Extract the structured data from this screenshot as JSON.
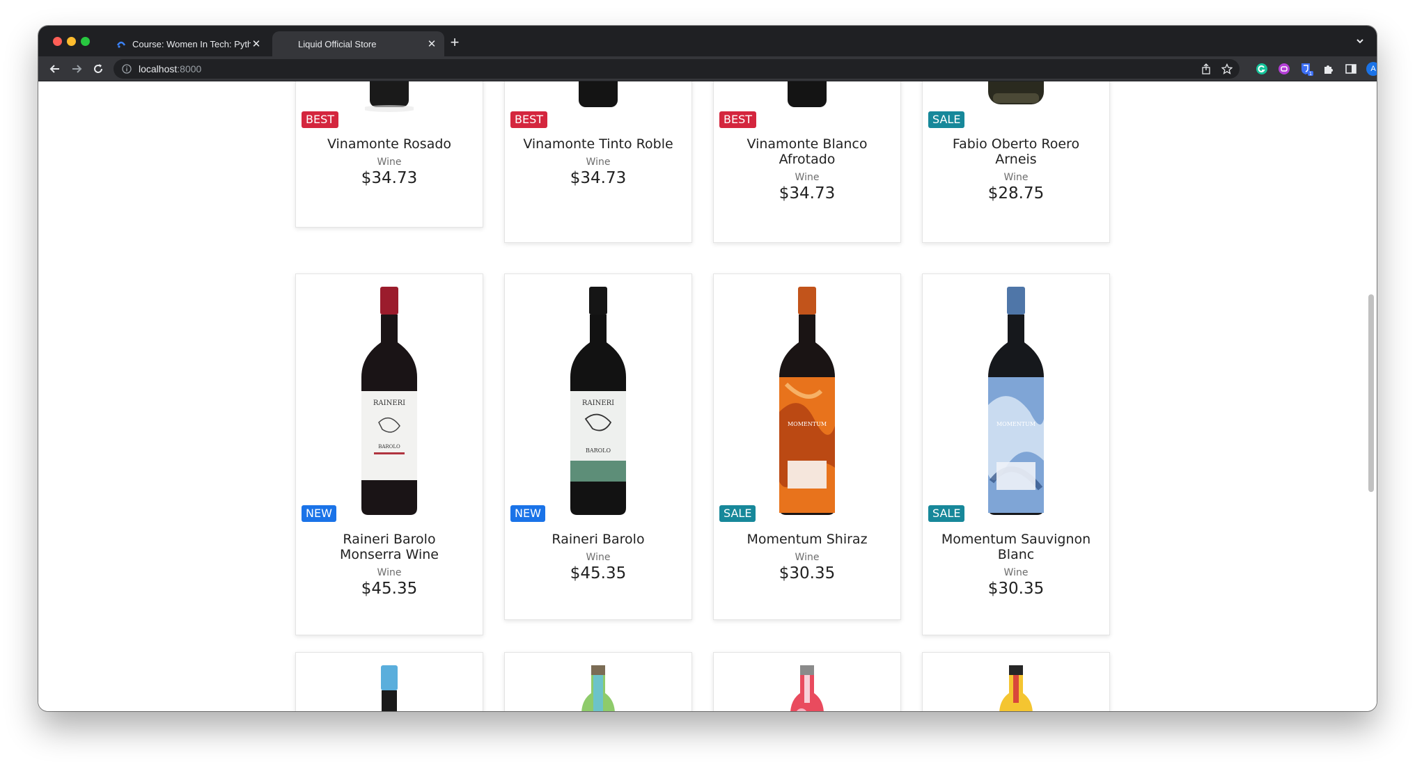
{
  "browser": {
    "tabs": [
      {
        "title": "Course: Women In Tech: Pytho",
        "active": false
      },
      {
        "title": "Liquid Official Store",
        "active": true
      }
    ],
    "url": {
      "host": "localhost",
      "port": ":8000"
    },
    "profile_initial": "A",
    "extension_badge": "1"
  },
  "products": [
    {
      "name": "Vinamonte Rosado",
      "category": "Wine",
      "price": "$34.73",
      "badge": "BEST",
      "row": 0
    },
    {
      "name": "Vinamonte Tinto Roble",
      "category": "Wine",
      "price": "$34.73",
      "badge": "BEST",
      "row": 0
    },
    {
      "name": "Vinamonte Blanco Afrotado",
      "category": "Wine",
      "price": "$34.73",
      "badge": "BEST",
      "row": 0
    },
    {
      "name": "Fabio Oberto Roero Arneis",
      "category": "Wine",
      "price": "$28.75",
      "badge": "SALE",
      "row": 0
    },
    {
      "name": "Raineri Barolo Monserra Wine",
      "category": "Wine",
      "price": "$45.35",
      "badge": "NEW",
      "row": 1,
      "label_text": "RAINERI",
      "label_sub": "BAROLO"
    },
    {
      "name": "Raineri Barolo",
      "category": "Wine",
      "price": "$45.35",
      "badge": "NEW",
      "row": 1,
      "label_text": "RAINERI",
      "label_sub": "BAROLO"
    },
    {
      "name": "Momentum Shiraz",
      "category": "Wine",
      "price": "$30.35",
      "badge": "SALE",
      "row": 1,
      "label_text": "MOMENTUM"
    },
    {
      "name": "Momentum Sauvignon Blanc",
      "category": "Wine",
      "price": "$30.35",
      "badge": "SALE",
      "row": 1,
      "label_text": "MOMENTUM"
    }
  ],
  "colors": {
    "badge_best": "#d4263e",
    "badge_sale": "#17889a",
    "badge_new": "#1a73e8"
  }
}
